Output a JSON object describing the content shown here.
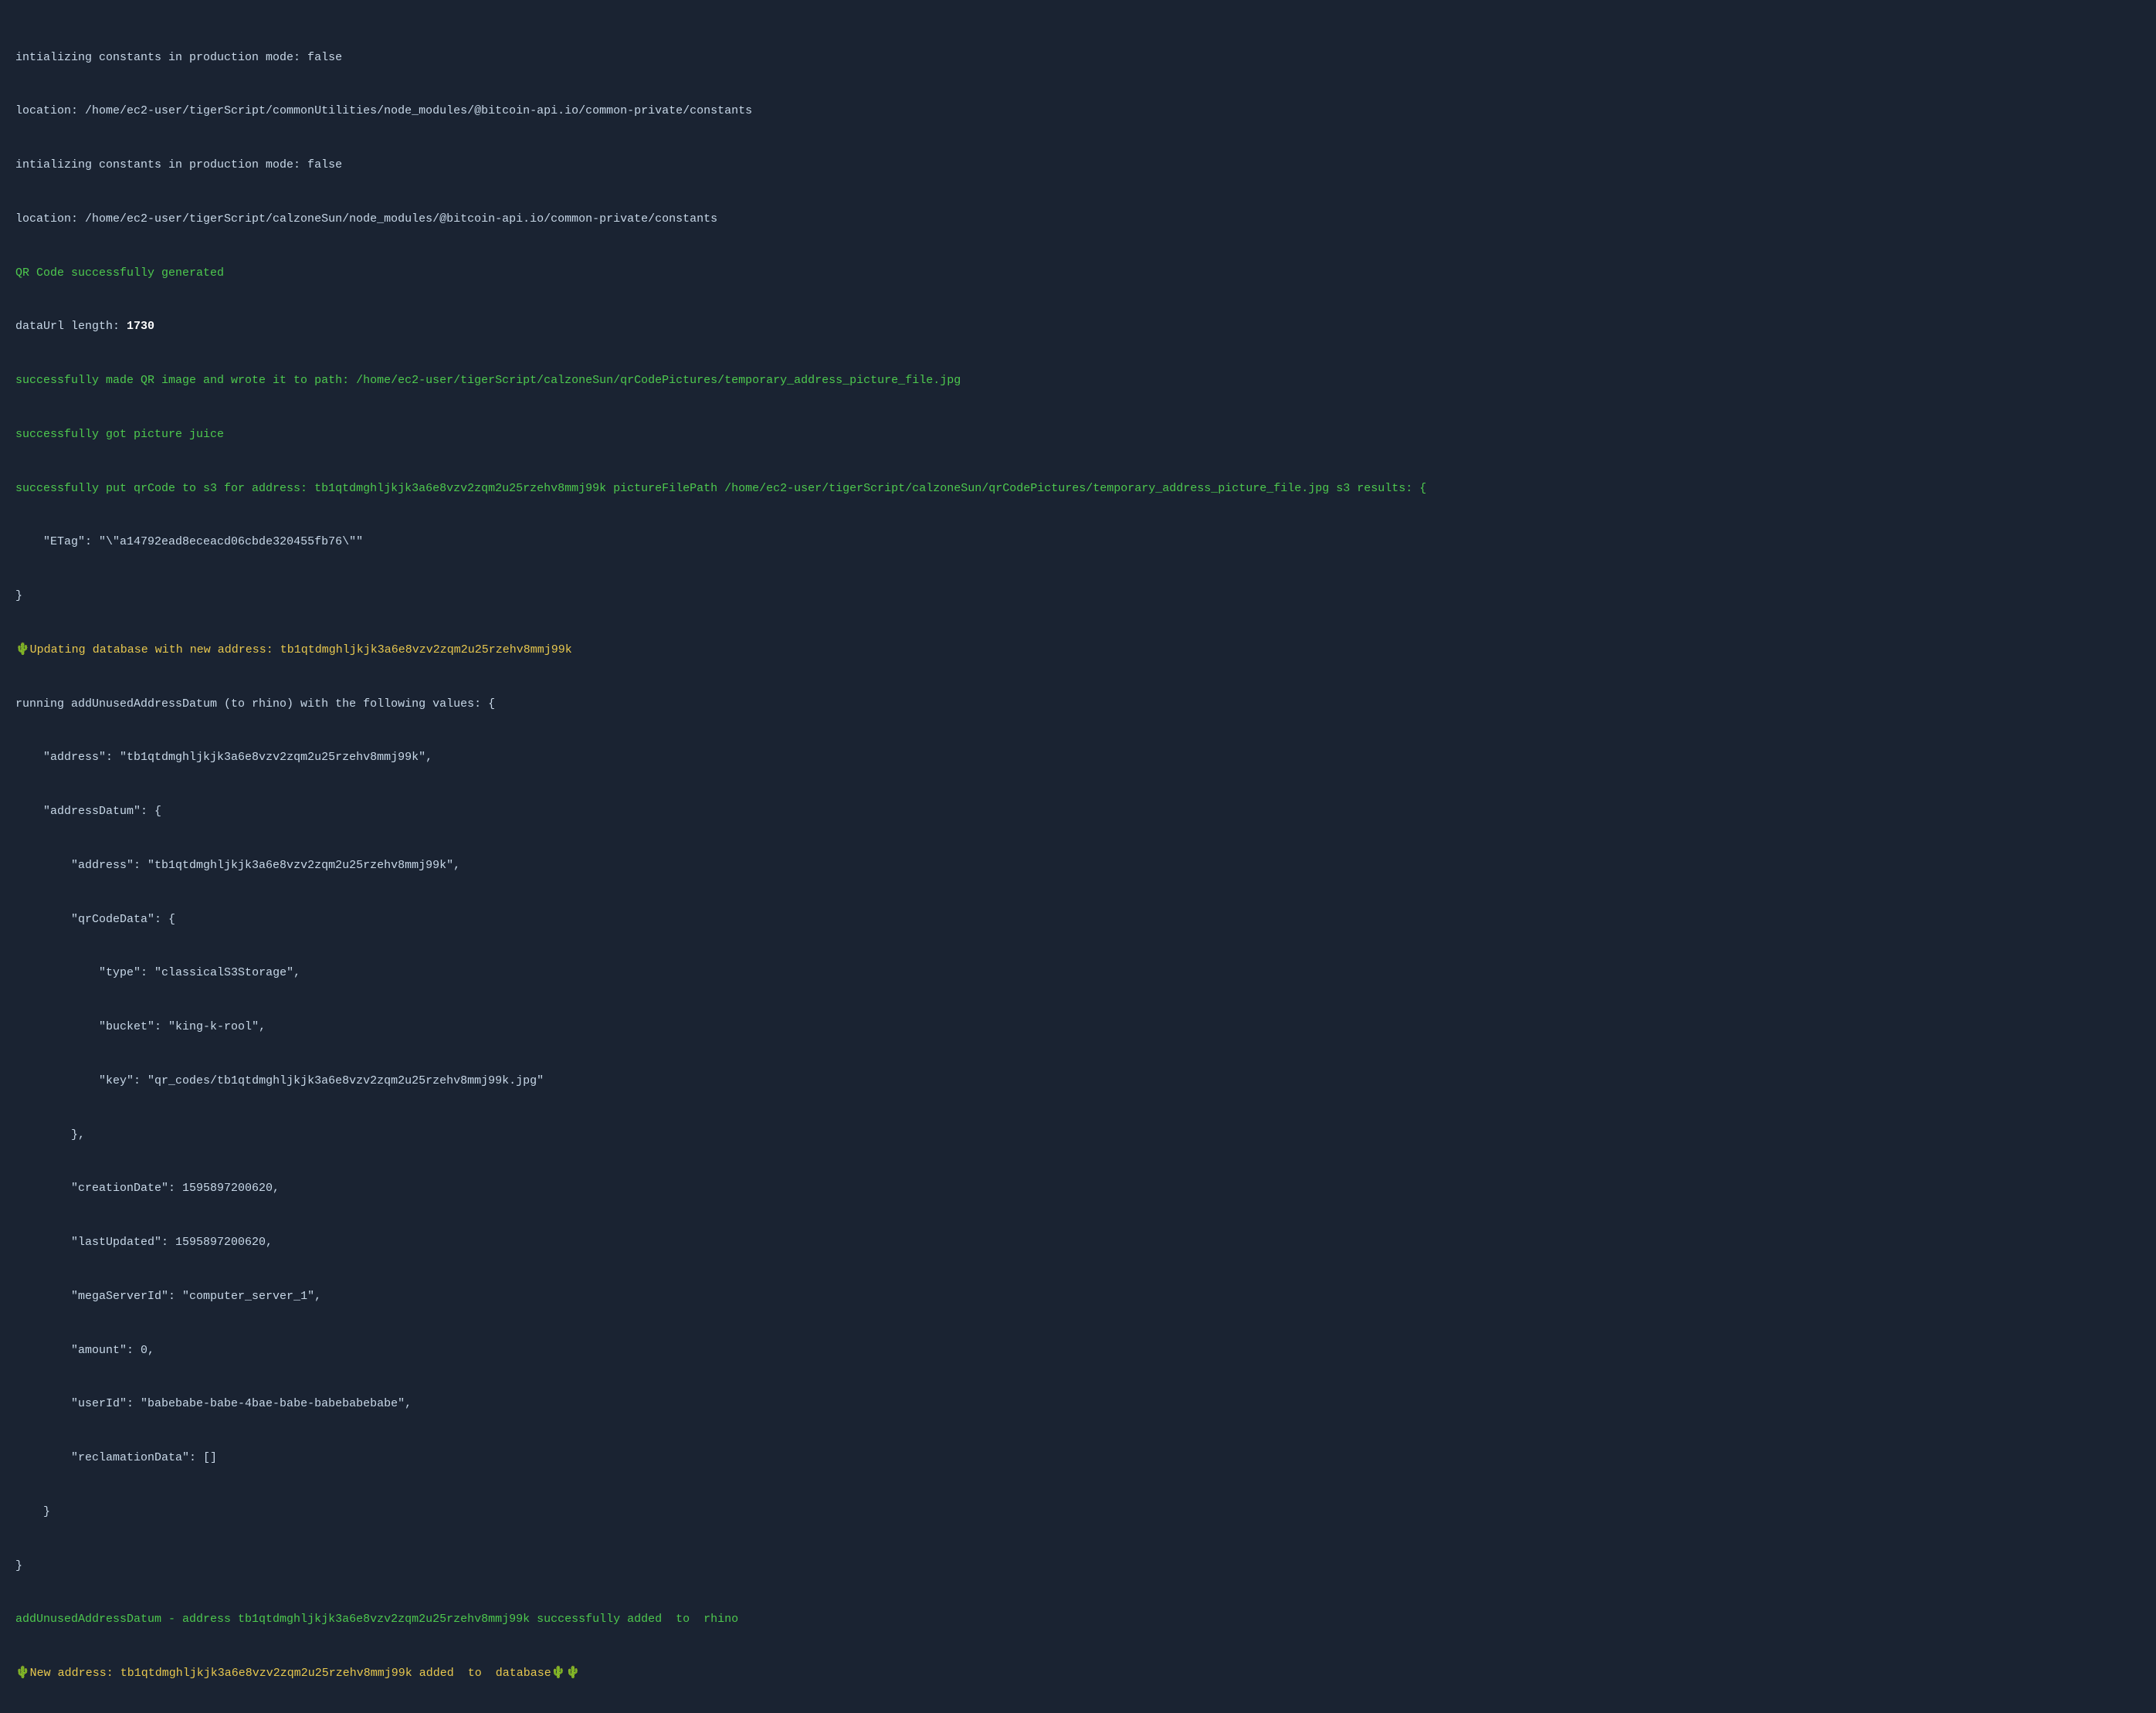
{
  "terminal": {
    "lines": [
      {
        "text": "intializing constants in production mode: false",
        "color": "normal"
      },
      {
        "text": "location: /home/ec2-user/tigerScript/commonUtilities/node_modules/@bitcoin-api.io/common-private/constants",
        "color": "normal"
      },
      {
        "text": "intializing constants in production mode: false",
        "color": "normal"
      },
      {
        "text": "location: /home/ec2-user/tigerScript/calzoneSun/node_modules/@bitcoin-api.io/common-private/constants",
        "color": "normal"
      },
      {
        "text": "QR Code successfully generated",
        "color": "green"
      },
      {
        "text": "dataUrl length: 1730",
        "color": "normal"
      },
      {
        "text": "successfully made QR image and wrote it to path: /home/ec2-user/tigerScript/calzoneSun/qrCodePictures/temporary_address_picture_file.jpg",
        "color": "green"
      },
      {
        "text": "successfully got picture juice",
        "color": "green"
      },
      {
        "text": "successfully put qrCode to s3 for address: tb1qtdmghljkjk3a6e8vzv2zqm2u25rzehv8mmj99k pictureFilePath /home/ec2-user/tigerScript/calzoneSun/qrCodePictures/temporary_address_picture_file.jpg s3 results: {",
        "color": "green"
      },
      {
        "text": "    \"ETag\": \"\\\"a14792ead8eceacd06cbde320455fb76\\\"\"",
        "color": "normal"
      },
      {
        "text": "}",
        "color": "normal"
      },
      {
        "text": "🌵Updating database with new address: tb1qtdmghljkjk3a6e8vzv2zqm2u25rzehv8mmj99k",
        "color": "yellow",
        "emoji_prefix": true
      },
      {
        "text": "running addUnusedAddressDatum (to rhino) with the following values: {",
        "color": "normal"
      },
      {
        "text": "    \"address\": \"tb1qtdmghljkjk3a6e8vzv2zqm2u25rzehv8mmj99k\",",
        "color": "normal"
      },
      {
        "text": "    \"addressDatum\": {",
        "color": "normal"
      },
      {
        "text": "        \"address\": \"tb1qtdmghljkjk3a6e8vzv2zqm2u25rzehv8mmj99k\",",
        "color": "normal"
      },
      {
        "text": "        \"qrCodeData\": {",
        "color": "normal"
      },
      {
        "text": "            \"type\": \"classicalS3Storage\",",
        "color": "normal"
      },
      {
        "text": "            \"bucket\": \"king-k-rool\",",
        "color": "normal"
      },
      {
        "text": "            \"key\": \"qr_codes/tb1qtdmghljkjk3a6e8vzv2zqm2u25rzehv8mmj99k.jpg\"",
        "color": "normal"
      },
      {
        "text": "        },",
        "color": "normal"
      },
      {
        "text": "        \"creationDate\": 1595897200620,",
        "color": "normal"
      },
      {
        "text": "        \"lastUpdated\": 1595897200620,",
        "color": "normal"
      },
      {
        "text": "        \"megaServerId\": \"computer_server_1\",",
        "color": "normal"
      },
      {
        "text": "        \"amount\": 0,",
        "color": "normal"
      },
      {
        "text": "        \"userId\": \"babebabe-babe-4bae-babe-babebabebabe\",",
        "color": "normal"
      },
      {
        "text": "        \"reclamationData\": []",
        "color": "normal"
      },
      {
        "text": "    }",
        "color": "normal"
      },
      {
        "text": "}",
        "color": "normal"
      },
      {
        "text": "addUnusedAddressDatum - address tb1qtdmghljkjk3a6e8vzv2zqm2u25rzehv8mmj99k successfully added to rhino",
        "color": "green"
      },
      {
        "text": "🌵New address: tb1qtdmghljkjk3a6e8vzv2zqm2u25rzehv8mmj99k added to database🌵🌵",
        "color": "yellow",
        "emoji_prefix": true
      }
    ]
  }
}
